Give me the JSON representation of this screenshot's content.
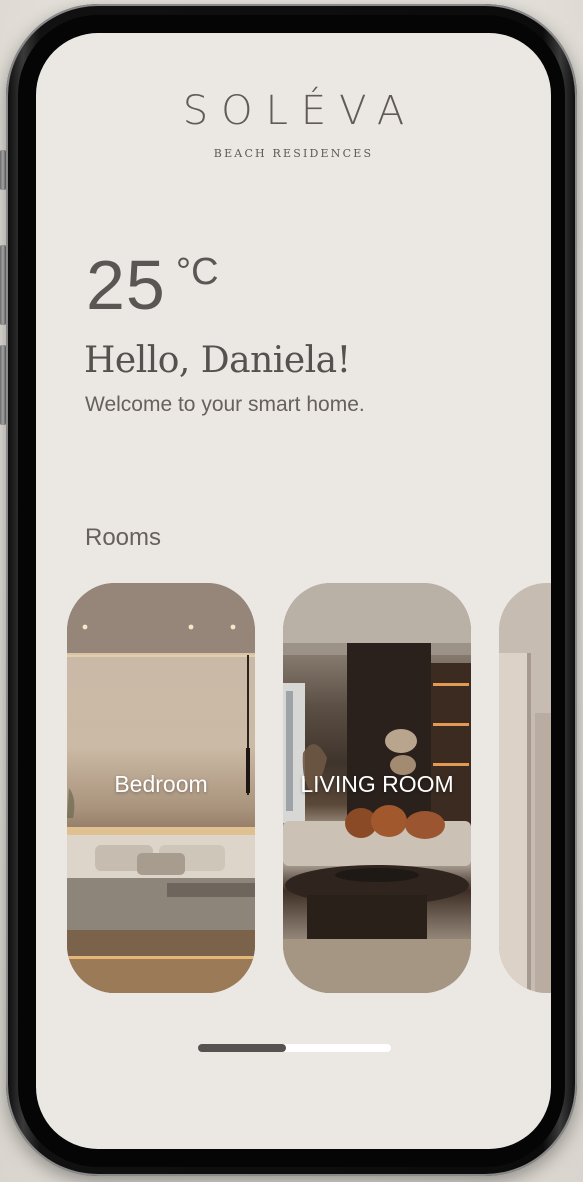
{
  "brand": {
    "name": "SOLÉVA",
    "subtitle": "BEACH RESIDENCES"
  },
  "weather": {
    "temperature": "25",
    "unit": "°C"
  },
  "greeting": {
    "hello": "Hello, Daniela!",
    "welcome": "Welcome to your smart home."
  },
  "rooms": {
    "title": "Rooms",
    "items": [
      {
        "label": "Bedroom"
      },
      {
        "label": "LIVING ROOM"
      },
      {
        "label": ""
      }
    ]
  },
  "pager": {
    "current_page": 1,
    "total_pages": 2
  },
  "colors": {
    "screen_background": "#ebe7e3",
    "text_primary": "#5a5653",
    "pager_active": "#555250",
    "pager_inactive": "#ffffff"
  }
}
